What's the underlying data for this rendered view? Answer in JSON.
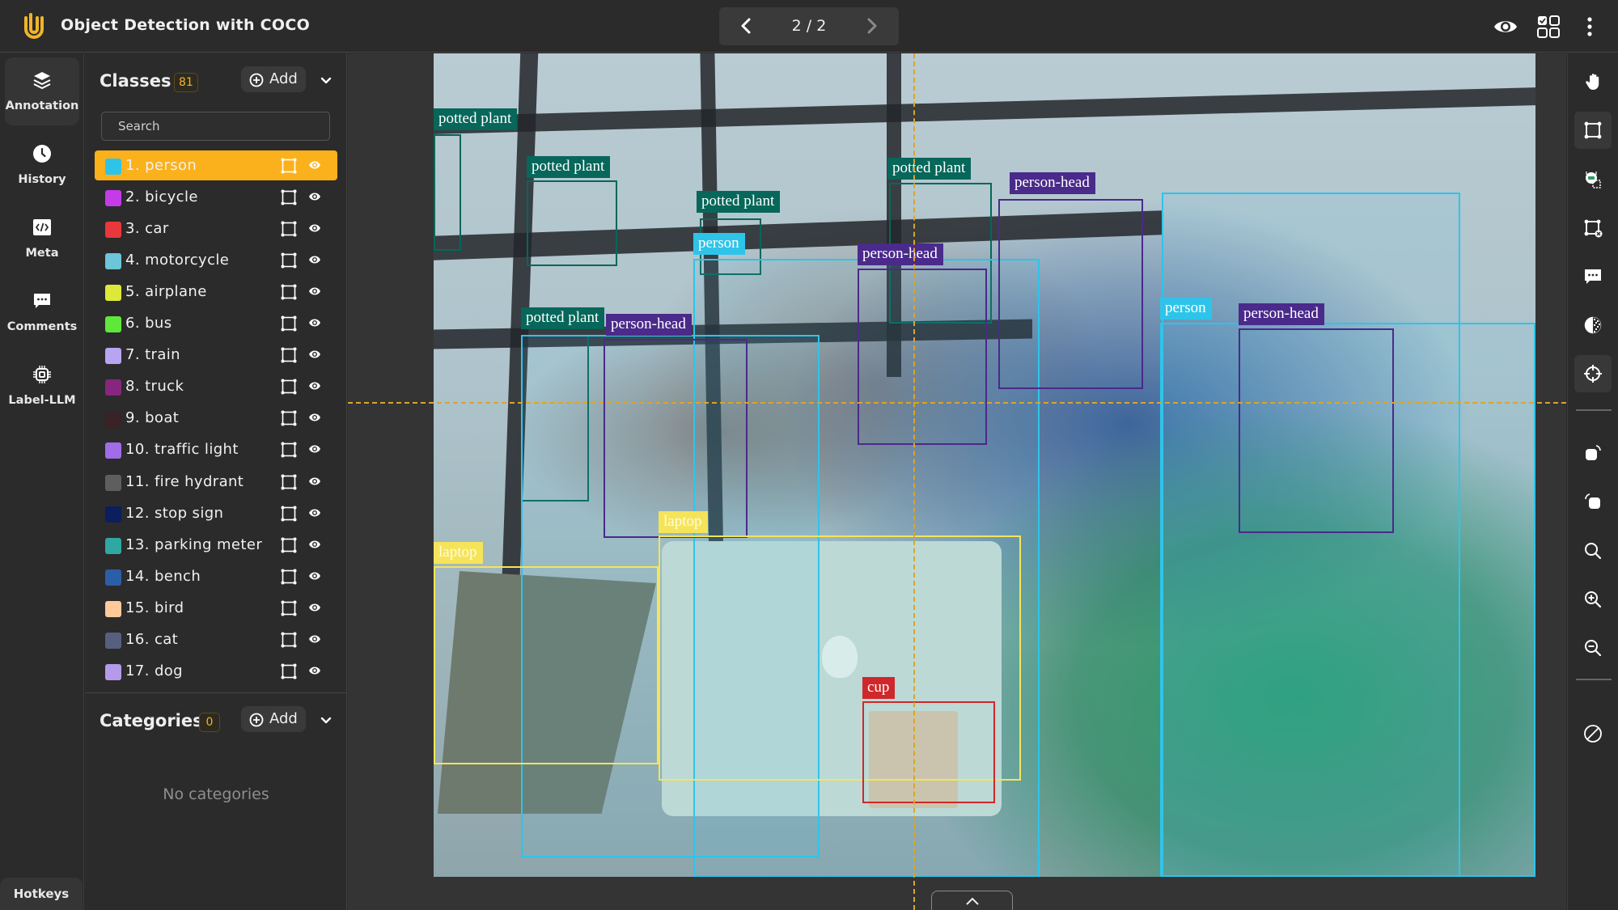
{
  "app": {
    "title": "Object Detection with COCO",
    "accent_color": "#fbb11c"
  },
  "pager": {
    "current": 2,
    "total": 2,
    "label": "2 / 2"
  },
  "top_right_icons": [
    "eye-icon",
    "grid-select-icon",
    "more-vertical-icon"
  ],
  "nav": {
    "items": [
      {
        "id": "annotation",
        "label": "Annotation",
        "icon": "layers-icon",
        "active": true
      },
      {
        "id": "history",
        "label": "History",
        "icon": "clock-icon",
        "active": false
      },
      {
        "id": "meta",
        "label": "Meta",
        "icon": "code-icon",
        "active": false
      },
      {
        "id": "comments",
        "label": "Comments",
        "icon": "comment-icon",
        "active": false
      },
      {
        "id": "label-llm",
        "label": "Label-LLM",
        "icon": "chip-icon",
        "active": false
      }
    ],
    "hotkeys_label": "Hotkeys"
  },
  "classes": {
    "title": "Classes",
    "count": "81",
    "add_label": "Add",
    "search_placeholder": "Search",
    "items": [
      {
        "label": "1. person",
        "color": "#2ec4ea",
        "active": true
      },
      {
        "label": "2. bicycle",
        "color": "#c53be8",
        "active": false
      },
      {
        "label": "3. car",
        "color": "#e8383b",
        "active": false
      },
      {
        "label": "4. motorcycle",
        "color": "#6cc5d9",
        "active": false
      },
      {
        "label": "5. airplane",
        "color": "#dde83a",
        "active": false
      },
      {
        "label": "6. bus",
        "color": "#5ee83a",
        "active": false
      },
      {
        "label": "7. train",
        "color": "#b8a4f2",
        "active": false
      },
      {
        "label": "8. truck",
        "color": "#86267e",
        "active": false
      },
      {
        "label": "9. boat",
        "color": "#3a2226",
        "active": false
      },
      {
        "label": "10. traffic light",
        "color": "#a06ce8",
        "active": false
      },
      {
        "label": "11. fire hydrant",
        "color": "#5e5e5e",
        "active": false
      },
      {
        "label": "12. stop sign",
        "color": "#0a1f5c",
        "active": false
      },
      {
        "label": "13. parking meter",
        "color": "#2ea8a0",
        "active": false
      },
      {
        "label": "14. bench",
        "color": "#2a5ea8",
        "active": false
      },
      {
        "label": "15. bird",
        "color": "#ffc99a",
        "active": false
      },
      {
        "label": "16. cat",
        "color": "#56607e",
        "active": false
      },
      {
        "label": "17. dog",
        "color": "#b49ae8",
        "active": false
      }
    ]
  },
  "categories": {
    "title": "Categories",
    "count": "0",
    "add_label": "Add",
    "empty_text": "No categories"
  },
  "annotations": {
    "label_colors": {
      "potted plant": "#06675a",
      "person": "#2ec4ea",
      "person-head": "#4a2a8a",
      "laptop": "#f5e45a",
      "cup": "#d0272b"
    },
    "labels": [
      "potted plant",
      "potted plant",
      "potted plant",
      "potted plant",
      "potted plant",
      "person",
      "person",
      "person",
      "person",
      "person-head",
      "person-head",
      "person-head",
      "person-head",
      "laptop",
      "laptop",
      "cup"
    ]
  },
  "tools": [
    {
      "id": "pan",
      "icon": "hand-icon",
      "active": false
    },
    {
      "id": "bbox",
      "icon": "bounding-box-icon",
      "active": true
    },
    {
      "id": "auto-annotate",
      "icon": "robot-box-icon",
      "active": false
    },
    {
      "id": "delete-box",
      "icon": "box-delete-icon",
      "active": false
    },
    {
      "id": "comment",
      "icon": "comment-icon",
      "active": false
    },
    {
      "id": "contrast",
      "icon": "contrast-icon",
      "active": false
    },
    {
      "id": "crosshair",
      "icon": "crosshair-icon",
      "active": true
    },
    {
      "id": "rotate-right",
      "icon": "rotate-right-icon",
      "active": false
    },
    {
      "id": "rotate-left",
      "icon": "rotate-left-icon",
      "active": false
    },
    {
      "id": "zoom-fit",
      "icon": "search-icon",
      "active": false
    },
    {
      "id": "zoom-in",
      "icon": "zoom-in-icon",
      "active": false
    },
    {
      "id": "zoom-out",
      "icon": "zoom-out-icon",
      "active": false
    },
    {
      "id": "disable",
      "icon": "disable-icon",
      "active": false
    }
  ]
}
